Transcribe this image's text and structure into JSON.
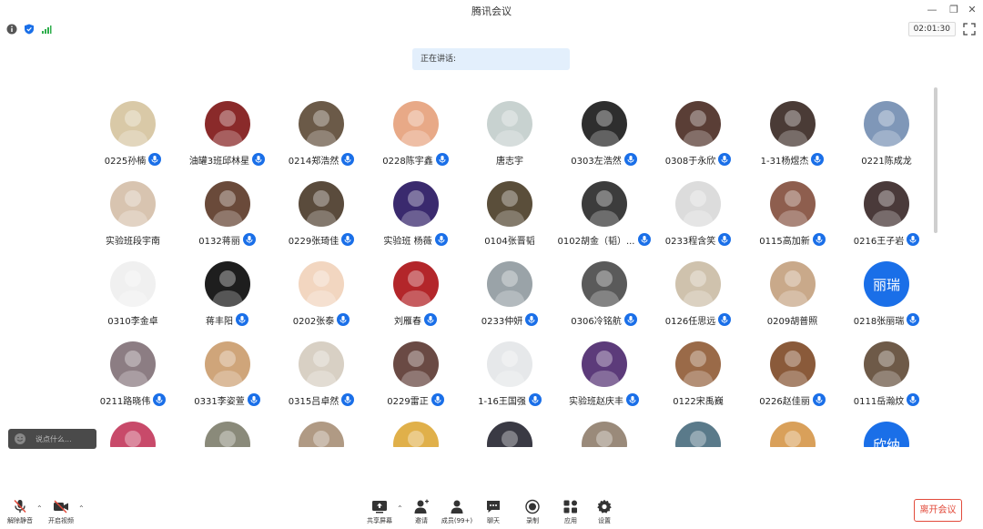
{
  "window": {
    "title": "腾讯会议"
  },
  "toolbar": {
    "timer": "02:01:30"
  },
  "speaking": {
    "label": "正在讲话:"
  },
  "participants": [
    {
      "name": "0225孙楠",
      "avatar_color": "#d9c9a7",
      "mic": true
    },
    {
      "name": "油罐3班邱林星",
      "avatar_color": "#8a2a2a",
      "mic": true
    },
    {
      "name": "0214郑浩然",
      "avatar_color": "#6b5a48",
      "mic": true
    },
    {
      "name": "0228陈宇鑫",
      "avatar_color": "#e8a987",
      "mic": true
    },
    {
      "name": "唐志宇",
      "avatar_color": "#c8d2d0",
      "mic": false
    },
    {
      "name": "0303左浩然",
      "avatar_color": "#2e2e2e",
      "mic": true
    },
    {
      "name": "0308于永欣",
      "avatar_color": "#5a3e36",
      "mic": true
    },
    {
      "name": "1-31杨煜杰",
      "avatar_color": "#4a3b36",
      "mic": true
    },
    {
      "name": "0221陈成龙",
      "avatar_color": "#7f97b8",
      "mic": false
    },
    {
      "name": "实验班段宇南",
      "avatar_color": "#d8c4b0",
      "mic": false
    },
    {
      "name": "0132蒋丽",
      "avatar_color": "#6a4a3a",
      "mic": true
    },
    {
      "name": "0229张琦佳",
      "avatar_color": "#5a4b3c",
      "mic": true
    },
    {
      "name": "实验班 杨薇",
      "avatar_color": "#3a2a6e",
      "mic": true
    },
    {
      "name": "0104张晋韬",
      "avatar_color": "#5a4e3a",
      "mic": false
    },
    {
      "name": "0102胡金（韬）...",
      "avatar_color": "#3c3c3c",
      "mic": true
    },
    {
      "name": "0233程含笑",
      "avatar_color": "#dcdcdc",
      "mic": true
    },
    {
      "name": "0115高加新",
      "avatar_color": "#8e5e4e",
      "mic": true
    },
    {
      "name": "0216王子岩",
      "avatar_color": "#4a3a3a",
      "mic": true
    },
    {
      "name": "0310李金卓",
      "avatar_color": "#f0f0f0",
      "mic": false
    },
    {
      "name": "蒋丰阳",
      "avatar_color": "#1e1e1e",
      "mic": true
    },
    {
      "name": "0202张泰",
      "avatar_color": "#f2d6c0",
      "mic": true
    },
    {
      "name": "刘雁春",
      "avatar_color": "#b3262a",
      "mic": true
    },
    {
      "name": "0233仲妍",
      "avatar_color": "#9aa3a8",
      "mic": true
    },
    {
      "name": "0306冷铭航",
      "avatar_color": "#5a5a5a",
      "mic": true
    },
    {
      "name": "0126任思远",
      "avatar_color": "#cfc2ad",
      "mic": true
    },
    {
      "name": "0209胡普照",
      "avatar_color": "#c9a98a",
      "mic": false
    },
    {
      "name": "0218张丽瑞",
      "avatar_color": "#1a6fe8",
      "mic": true,
      "text_avatar": "丽瑞"
    },
    {
      "name": "0211路晓伟",
      "avatar_color": "#8c7d83",
      "mic": true
    },
    {
      "name": "0331李姿萱",
      "avatar_color": "#cfa57a",
      "mic": true
    },
    {
      "name": "0315吕卓然",
      "avatar_color": "#d8d0c4",
      "mic": true
    },
    {
      "name": "0229雷正",
      "avatar_color": "#6a4a44",
      "mic": true
    },
    {
      "name": "1-16王国强",
      "avatar_color": "#e6e8ea",
      "mic": true
    },
    {
      "name": "实验班赵庆丰",
      "avatar_color": "#5c3b7a",
      "mic": true
    },
    {
      "name": "0122宋禹巍",
      "avatar_color": "#9a6a48",
      "mic": false
    },
    {
      "name": "0226赵佳丽",
      "avatar_color": "#8a5a3a",
      "mic": true
    },
    {
      "name": "0111岳瀚炆",
      "avatar_color": "#6e5a48",
      "mic": true
    },
    {
      "name": "",
      "avatar_color": "#c84a6a",
      "mic": false
    },
    {
      "name": "",
      "avatar_color": "#8a8a7a",
      "mic": false
    },
    {
      "name": "",
      "avatar_color": "#b09a84",
      "mic": false
    },
    {
      "name": "",
      "avatar_color": "#e0b04a",
      "mic": false
    },
    {
      "name": "",
      "avatar_color": "#3a3a44",
      "mic": false
    },
    {
      "name": "",
      "avatar_color": "#9a8a7a",
      "mic": false
    },
    {
      "name": "",
      "avatar_color": "#5a7a8a",
      "mic": false
    },
    {
      "name": "",
      "avatar_color": "#d9a05a",
      "mic": false
    },
    {
      "name": "",
      "avatar_color": "#1a6fe8",
      "mic": false,
      "text_avatar": "欣纳"
    }
  ],
  "chat": {
    "placeholder": "说点什么..."
  },
  "bottom": {
    "unmute": "解除静音",
    "start_video": "开启视频",
    "share_screen": "共享屏幕",
    "invite": "邀请",
    "members": "成员(99+)",
    "chat": "聊天",
    "record": "录制",
    "apps": "应用",
    "settings": "设置",
    "leave": "离开会议"
  },
  "colors": {
    "accent": "#1a6fe8",
    "leave": "#e24b3b",
    "speaking_bg": "#e3effc"
  }
}
